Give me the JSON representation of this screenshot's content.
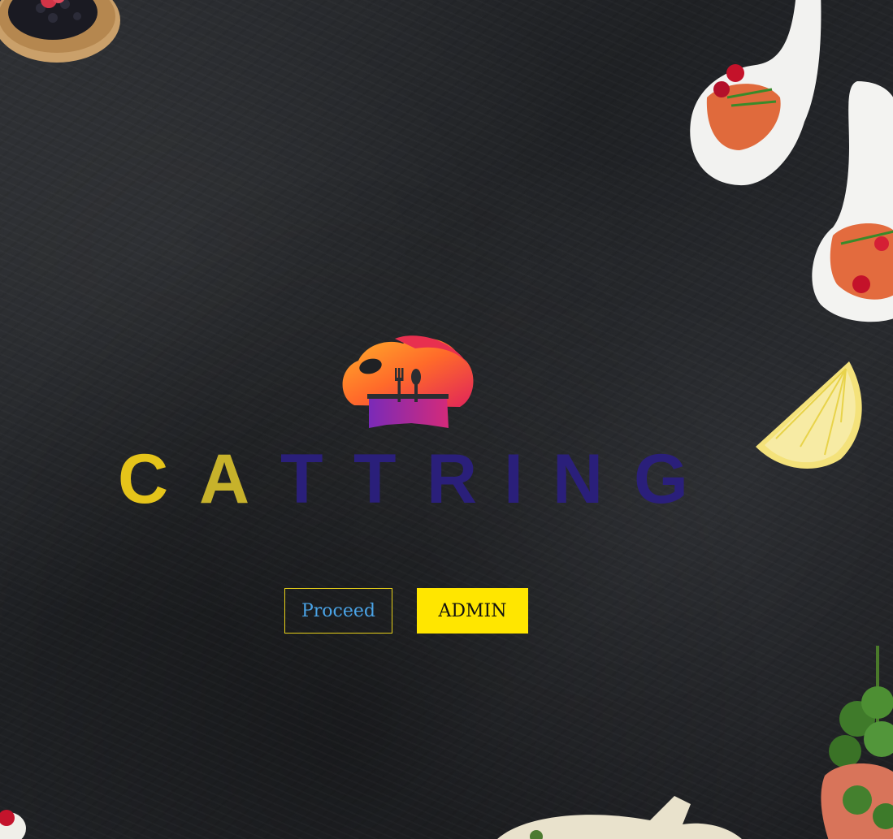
{
  "brand": {
    "letters": [
      "C",
      "A",
      "T",
      "T",
      "R",
      "I",
      "N",
      "G"
    ],
    "letter_colors": [
      "#e5c41a",
      "#c7b22b",
      "#2a1f7a",
      "#2a1f7a",
      "#2a1f7a",
      "#2a1f7a",
      "#2a1f7a",
      "#2a1f7a"
    ],
    "logo_icon": "chef-hat-fork-spoon-icon"
  },
  "actions": {
    "proceed_label": "Proceed",
    "admin_label": "ADMIN"
  },
  "colors": {
    "accent_yellow": "#ffe600",
    "proceed_text": "#4aa3e6",
    "background": "#222428"
  }
}
